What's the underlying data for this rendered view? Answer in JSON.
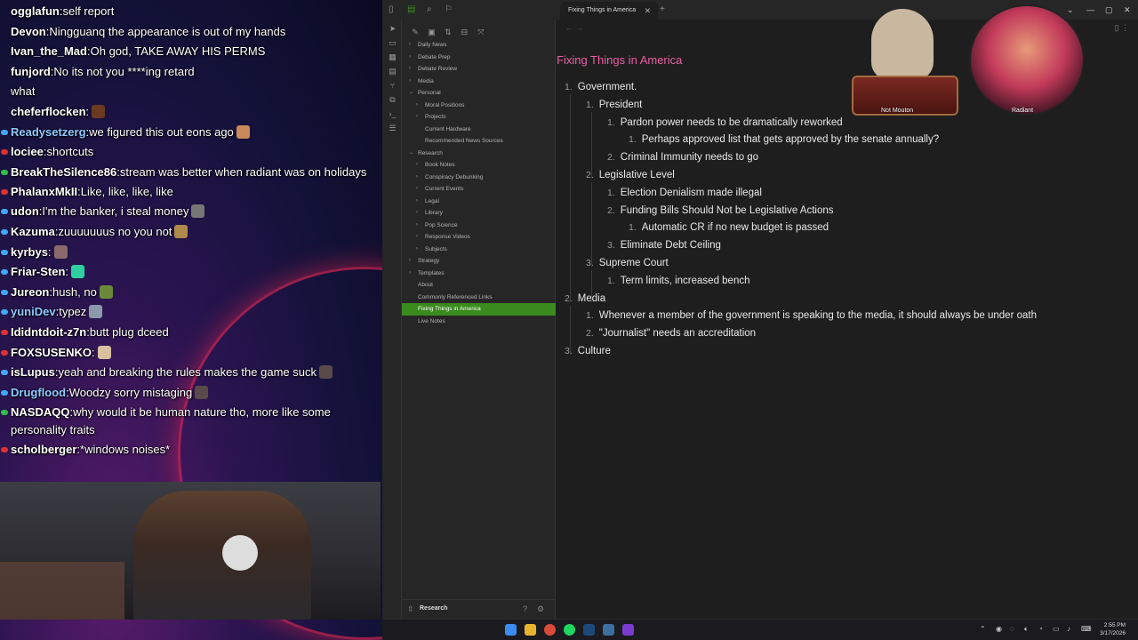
{
  "chat": [
    {
      "user": "ogglafun",
      "text": "self report",
      "mark": "none",
      "user_color": "#ffffff"
    },
    {
      "user": "Devon",
      "text": "Ningguanq the appearance is out of my hands",
      "mark": "none",
      "user_color": "#ffffff"
    },
    {
      "user": "Ivan_the_Mad",
      "text": "Oh god, TAKE AWAY HIS PERMS",
      "mark": "none",
      "user_color": "#ffffff"
    },
    {
      "user": "funjord",
      "text": "No its not you ****ing retard",
      "mark": "none",
      "user_color": "#ffffff"
    },
    {
      "user": "",
      "text": "what",
      "mark": "none",
      "user_color": "#ffffff"
    },
    {
      "user": "cheferflocken",
      "text": "",
      "mark": "none",
      "user_color": "#ffffff",
      "emote": "#6b3a20"
    },
    {
      "user": "Readysetzerg",
      "text": "we figured this out eons ago",
      "mark": "#3fa9f5",
      "user_color": "#8ec8ff",
      "emote": "#c98a5a"
    },
    {
      "user": "lociee",
      "text": "shortcuts",
      "mark": "#e03030",
      "user_color": "#ffffff"
    },
    {
      "user": "BreakTheSilence86",
      "text": "stream was better when radiant was on holidays",
      "mark": "#2fbf4a",
      "user_color": "#ffffff",
      "wrap": true
    },
    {
      "user": "PhalanxMkII",
      "text": "Like, like, like, like",
      "mark": "#e03030",
      "user_color": "#ffffff"
    },
    {
      "user": "udon",
      "text": "I'm the banker, i steal money",
      "mark": "#3fa9f5",
      "user_color": "#ffffff",
      "emote": "#777777"
    },
    {
      "user": "Kazuma",
      "text": "zuuuuuuus no you not",
      "mark": "#3fa9f5",
      "user_color": "#ffffff",
      "emote": "#b08a4a"
    },
    {
      "user": "kyrbys",
      "text": "",
      "mark": "#3fa9f5",
      "user_color": "#ffffff",
      "emote": "#8a6a6a"
    },
    {
      "user": "Friar-Sten",
      "text": "",
      "mark": "#3fa9f5",
      "user_color": "#ffffff",
      "emote": "#2fd0a0"
    },
    {
      "user": "Jureon",
      "text": "hush, no",
      "mark": "#3fa9f5",
      "user_color": "#ffffff",
      "emote": "#6a8a3a"
    },
    {
      "user": "yuniDev",
      "text": "typez",
      "mark": "#3fa9f5",
      "user_color": "#8ec8ff",
      "emote": "#8a9aaa"
    },
    {
      "user": "Ididntdoit-z7n",
      "text": "butt plug dceed",
      "mark": "#e03030",
      "user_color": "#ffffff"
    },
    {
      "user": "FOXSUSENKO",
      "text": "",
      "mark": "#e03030",
      "user_color": "#ffffff",
      "emote": "#d9c0a0"
    },
    {
      "user": "isLupus",
      "text": "yeah and breaking the rules makes the game suck",
      "mark": "#3fa9f5",
      "user_color": "#ffffff",
      "emote": "#5a4a4a"
    },
    {
      "user": "Drugflood",
      "text": "Woodzy sorry mistaging",
      "mark": "#3fa9f5",
      "user_color": "#8ec8ff",
      "emote": "#5a4a4a"
    },
    {
      "user": "NASDAQQ",
      "text": "why would it be human nature tho, more like some personality traits",
      "mark": "#2fbf4a",
      "user_color": "#ffffff",
      "wrap": true
    },
    {
      "user": "scholberger",
      "text": "*windows noises*",
      "mark": "#e03030",
      "user_color": "#ffffff"
    }
  ],
  "app": {
    "tab_title": "Fixing Things in America",
    "note_title": "Fixing Things in America",
    "vault_name": "Research",
    "accent_color": "#3a8a1e",
    "title_color": "#e85fa3"
  },
  "sidebar": [
    {
      "label": "Daily News",
      "depth": 0,
      "folder": true,
      "open": false
    },
    {
      "label": "Debate Prep",
      "depth": 0,
      "folder": true,
      "open": false
    },
    {
      "label": "Debate Review",
      "depth": 0,
      "folder": true,
      "open": false
    },
    {
      "label": "Media",
      "depth": 0,
      "folder": true,
      "open": false
    },
    {
      "label": "Personal",
      "depth": 0,
      "folder": true,
      "open": true
    },
    {
      "label": "Moral Positions",
      "depth": 1,
      "folder": true,
      "open": false
    },
    {
      "label": "Projects",
      "depth": 1,
      "folder": true,
      "open": false
    },
    {
      "label": "Current Hardware",
      "depth": 1,
      "folder": false
    },
    {
      "label": "Recommended News Sources",
      "depth": 1,
      "folder": false
    },
    {
      "label": "Research",
      "depth": 0,
      "folder": true,
      "open": true
    },
    {
      "label": "Book Notes",
      "depth": 1,
      "folder": true,
      "open": false
    },
    {
      "label": "Conspiracy Debunking",
      "depth": 1,
      "folder": true,
      "open": false
    },
    {
      "label": "Current Events",
      "depth": 1,
      "folder": true,
      "open": false
    },
    {
      "label": "Legal",
      "depth": 1,
      "folder": true,
      "open": false
    },
    {
      "label": "Library",
      "depth": 1,
      "folder": true,
      "open": false
    },
    {
      "label": "Pop Science",
      "depth": 1,
      "folder": true,
      "open": false
    },
    {
      "label": "Response Videos",
      "depth": 1,
      "folder": true,
      "open": false
    },
    {
      "label": "Subjects",
      "depth": 1,
      "folder": true,
      "open": false
    },
    {
      "label": "Strategy",
      "depth": 0,
      "folder": true,
      "open": false
    },
    {
      "label": "Templates",
      "depth": 0,
      "folder": true,
      "open": false
    },
    {
      "label": "About",
      "depth": 0,
      "folder": false
    },
    {
      "label": "Commonly Referenced Links",
      "depth": 0,
      "folder": false
    },
    {
      "label": "Fixing Things in America",
      "depth": 0,
      "folder": false,
      "active": true
    },
    {
      "label": "Live Notes",
      "depth": 0,
      "folder": false
    }
  ],
  "outline": [
    {
      "num": "1.",
      "text": "Government.",
      "depth": 0
    },
    {
      "num": "1.",
      "text": "President",
      "depth": 1
    },
    {
      "num": "1.",
      "text": "Pardon power needs to be dramatically reworked",
      "depth": 2
    },
    {
      "num": "1.",
      "text": "Perhaps approved list that gets approved by the senate annually?",
      "depth": 3
    },
    {
      "num": "2.",
      "text": "Criminal Immunity needs to go",
      "depth": 2
    },
    {
      "num": "2.",
      "text": "Legislative Level",
      "depth": 1
    },
    {
      "num": "1.",
      "text": "Election Denialism made illegal",
      "depth": 2
    },
    {
      "num": "2.",
      "text": "Funding Bills Should Not be Legislative Actions",
      "depth": 2
    },
    {
      "num": "1.",
      "text": "Automatic CR if no new budget is passed",
      "depth": 3
    },
    {
      "num": "3.",
      "text": "Eliminate Debt Ceiling",
      "depth": 2
    },
    {
      "num": "3.",
      "text": "Supreme Court",
      "depth": 1
    },
    {
      "num": "1.",
      "text": "Term limits, increased bench",
      "depth": 2
    },
    {
      "num": "2.",
      "text": "Media",
      "depth": 0
    },
    {
      "num": "1.",
      "text": "Whenever a member of the government is speaking to the media, it should always be under oath",
      "depth": 1
    },
    {
      "num": "2.",
      "text": "\"Journalist\" needs an accreditation",
      "depth": 1
    },
    {
      "num": "3.",
      "text": "Culture",
      "depth": 0
    }
  ],
  "overlay": {
    "left_label": "Not Mouton",
    "right_label": "Radiant"
  },
  "taskbar": {
    "time": "2:55 PM",
    "date": "3/17/2026"
  }
}
